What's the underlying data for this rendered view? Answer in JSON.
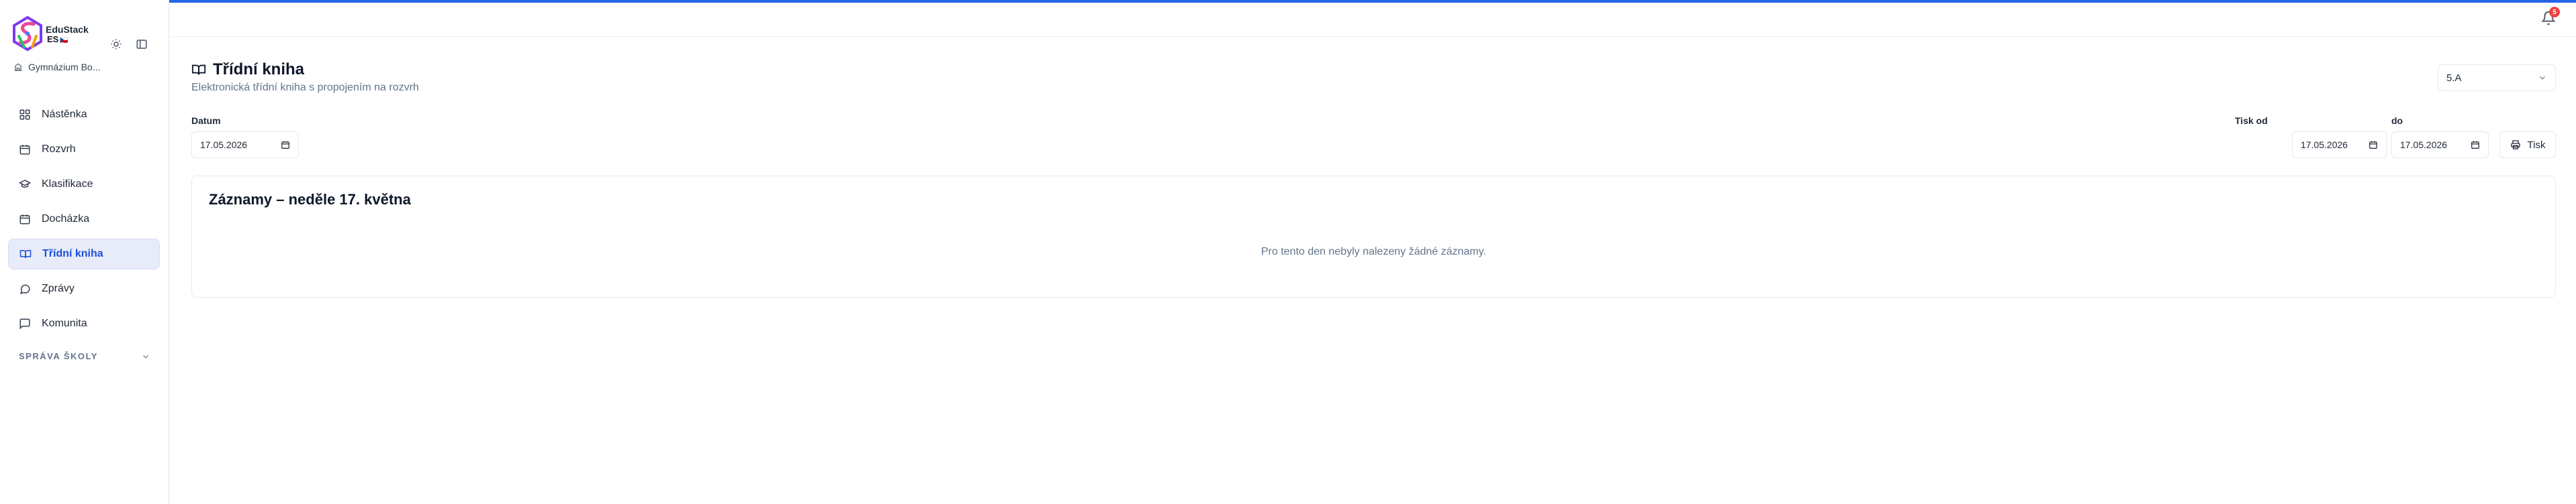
{
  "brand": {
    "name": "EduStack",
    "sub": "ES",
    "flag": "🇨🇿"
  },
  "school": {
    "name": "Gymnázium Bo..."
  },
  "sidebar": {
    "items": [
      {
        "label": "Nástěnka",
        "icon": "grid-icon"
      },
      {
        "label": "Rozvrh",
        "icon": "calendar-icon"
      },
      {
        "label": "Klasifikace",
        "icon": "graduation-cap-icon"
      },
      {
        "label": "Docházka",
        "icon": "calendar-check-icon"
      },
      {
        "label": "Třídní kniha",
        "icon": "book-open-icon",
        "active": true
      },
      {
        "label": "Zprávy",
        "icon": "message-icon"
      },
      {
        "label": "Komunita",
        "icon": "message-square-icon"
      }
    ],
    "section": "SPRÁVA ŠKOLY"
  },
  "header": {
    "notifications": "5"
  },
  "page": {
    "title": "Třídní kniha",
    "subtitle": "Elektronická třídní kniha s propojením na rozvrh",
    "class_select": "5.A"
  },
  "filters": {
    "date_label": "Datum",
    "date_value": "17.05.2026",
    "print_from_label": "Tisk od",
    "print_from_value": "17.05.2026",
    "print_to_label": "do",
    "print_to_value": "17.05.2026",
    "print_button": "Tisk"
  },
  "records": {
    "title": "Záznamy – neděle 17. května",
    "empty": "Pro tento den nebyly nalezeny žádné záznamy."
  },
  "colors": {
    "accent": "#2563eb",
    "active_bg": "#e8ecf9",
    "badge": "#ef4444"
  }
}
